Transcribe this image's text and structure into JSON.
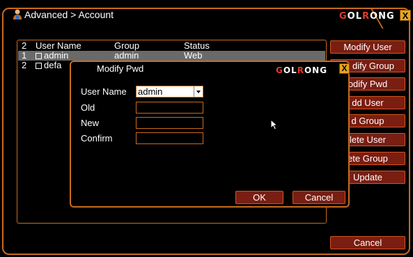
{
  "window": {
    "title": "Advanced > Account",
    "brand": {
      "pre": "",
      "mark": "G",
      "mid": "OL",
      "mark2": "R",
      "post": "ONG"
    },
    "close": "X"
  },
  "table": {
    "count": "2",
    "headers": {
      "name": "User Name",
      "group": "Group",
      "status": "Status"
    },
    "rows": [
      {
        "index": "1",
        "name": "admin",
        "group": "admin",
        "status": "Web"
      },
      {
        "index": "2",
        "name": "defa"
      }
    ]
  },
  "buttons": {
    "modify_user": "Modify User",
    "modify_group": "Modify Group",
    "modify_pwd": "odify Pwd",
    "add_user": "dd User",
    "add_group": "d Group",
    "delete_user": "lete User",
    "delete_group": "ete Group",
    "update": "Update",
    "cancel": "Cancel",
    "modify_group_prefix": "I",
    "modify_group_suffix": "dify Group"
  },
  "dialog": {
    "title": "Modify Pwd",
    "close": "X",
    "user_name_label": "User Name",
    "user_name_value": "admin",
    "old_label": "Old",
    "new_label": "New",
    "confirm_label": "Confirm",
    "ok": "OK",
    "cancel": "Cancel"
  },
  "colors": {
    "accent": "#c96b1d",
    "button_bg": "#7a1e12",
    "logo_red": "#e23a2b"
  }
}
